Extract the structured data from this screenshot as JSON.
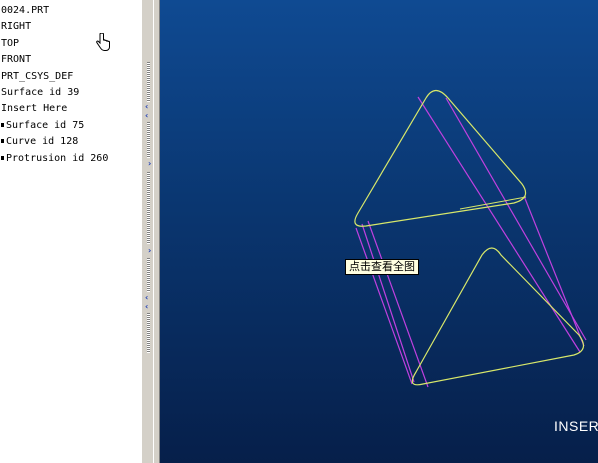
{
  "model_tree": {
    "items": [
      {
        "label": "0024.PRT",
        "marked": false
      },
      {
        "label": "RIGHT",
        "marked": false
      },
      {
        "label": "TOP",
        "marked": false
      },
      {
        "label": "FRONT",
        "marked": false
      },
      {
        "label": "PRT_CSYS_DEF",
        "marked": false
      },
      {
        "label": "Surface id 39",
        "marked": false
      },
      {
        "label": "Insert Here",
        "marked": false
      },
      {
        "label": "Surface id 75",
        "marked": true
      },
      {
        "label": "Curve id 128",
        "marked": true
      },
      {
        "label": "Protrusion id 260",
        "marked": true
      }
    ]
  },
  "viewport": {
    "tooltip": "点击查看全图",
    "mode_label": "INSER",
    "colors": {
      "background_top": "#0f4a92",
      "background_bottom": "#061f4a",
      "edge_yellow": "#d8e86a",
      "edge_magenta": "#c040e0"
    }
  },
  "icons": {
    "cursor": "hand-pointer-icon",
    "sash_arrows": [
      "collapse-left-icon",
      "expand-right-icon",
      "expand-right-icon",
      "collapse-left-icon"
    ]
  }
}
